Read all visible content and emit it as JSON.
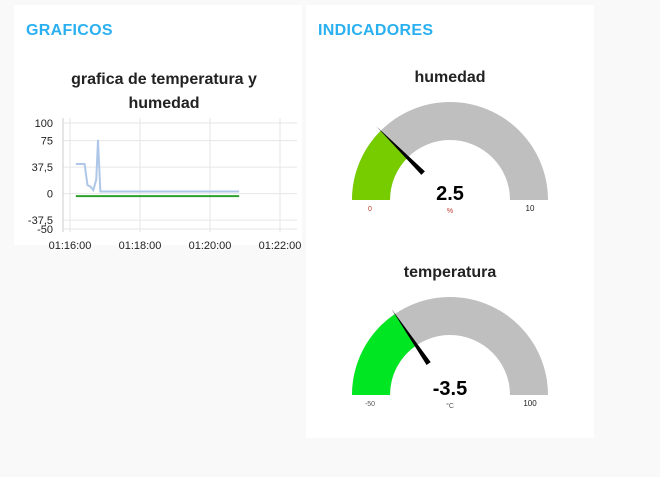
{
  "graficos": {
    "title": "GRAFICOS"
  },
  "indicadores": {
    "title": "INDICADORES"
  },
  "chart_data": {
    "type": "line",
    "title": "grafica de temperatura y humedad",
    "xlabel": "",
    "ylabel": "",
    "ylim": [
      -50,
      100
    ],
    "yticks": [
      "100",
      "75",
      "37,5",
      "0",
      "-37,5",
      "-50"
    ],
    "ytick_values": [
      100,
      75,
      37.5,
      0,
      -37.5,
      -50
    ],
    "xticks": [
      "01:16:00",
      "01:18:00",
      "01:20:00",
      "01:22:00"
    ],
    "xtick_seconds": [
      0,
      120,
      240,
      360
    ],
    "grid": true,
    "series": [
      {
        "name": "humedad",
        "color": "#aec7e8",
        "x": [
          10,
          25,
          30,
          35,
          40,
          45,
          48,
          52,
          290
        ],
        "y": [
          42,
          42,
          12,
          10,
          5,
          20,
          76,
          3,
          3
        ]
      },
      {
        "name": "temperatura",
        "color": "#2ca02c",
        "x": [
          10,
          290
        ],
        "y": [
          -3.5,
          -3.5
        ]
      }
    ]
  },
  "gauges": [
    {
      "title": "humedad",
      "value": "2.5",
      "num": 2.5,
      "min": 0,
      "max": 10,
      "min_label": "0",
      "max_label": "10",
      "units": "%",
      "color": "#77cc00",
      "min_color": "#c0392b"
    },
    {
      "title": "temperatura",
      "value": "-3.5",
      "num": -3.5,
      "min": -50,
      "max": 100,
      "min_label": "-50",
      "max_label": "100",
      "units": "°C",
      "color": "#00e622",
      "min_color": "#555"
    }
  ]
}
